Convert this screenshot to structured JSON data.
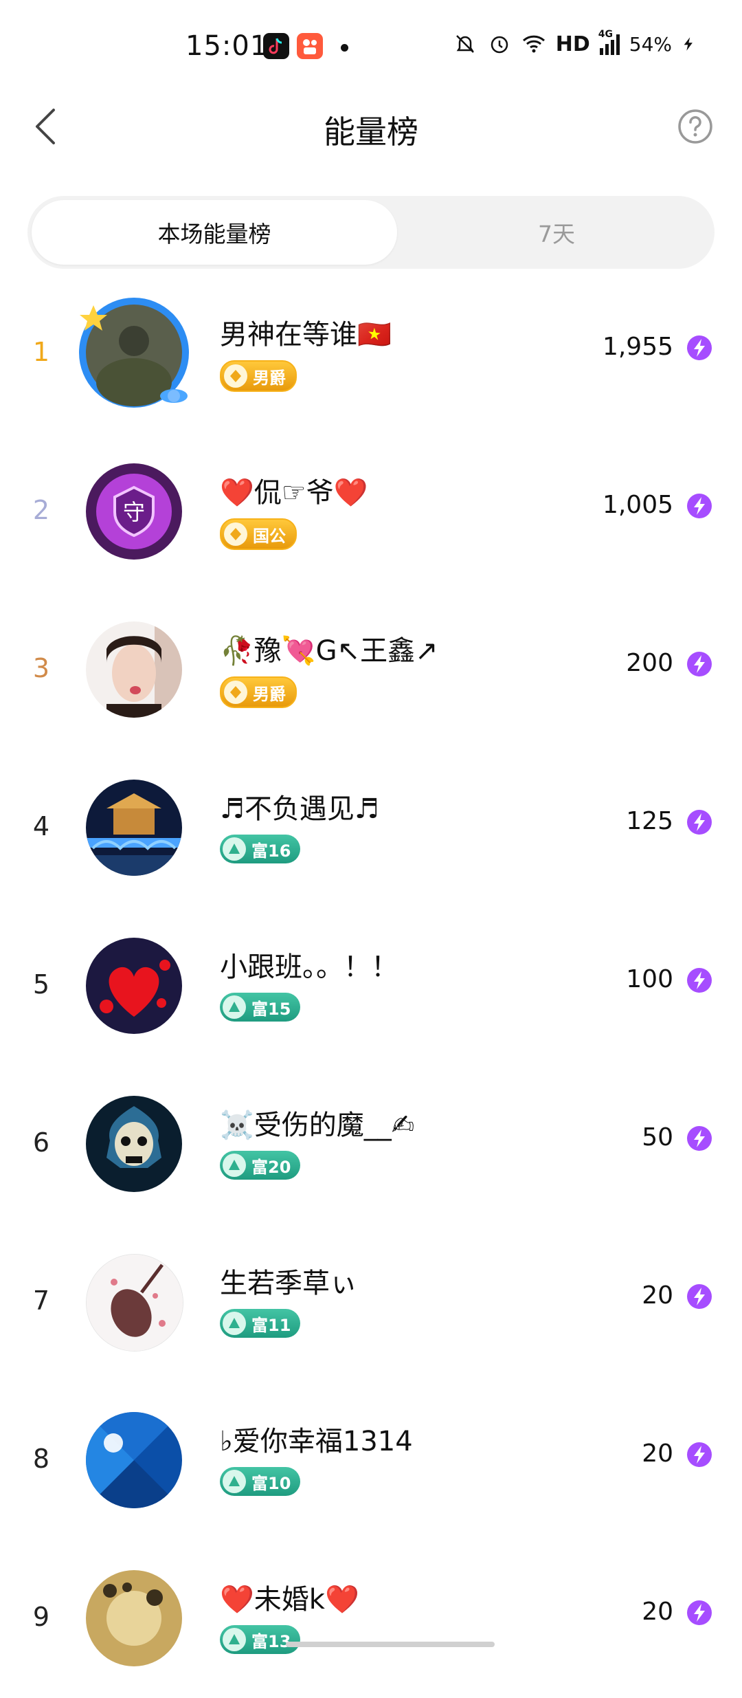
{
  "status_bar": {
    "time": "15:01",
    "network": "HD",
    "signal_label": "4G",
    "battery": "54%"
  },
  "header": {
    "title": "能量榜",
    "back_icon": "chevron-left-icon",
    "help_icon": "question-circle-icon"
  },
  "tabs": [
    {
      "label": "本场能量榜",
      "active": true
    },
    {
      "label": "7天",
      "active": false
    }
  ],
  "ranking": [
    {
      "rank": "1",
      "name": "男神在等谁🇻🇳",
      "badge": "男爵",
      "badge_type": "gold",
      "energy": "1,955"
    },
    {
      "rank": "2",
      "name": "❤️侃☞爷❤️",
      "badge": "国公",
      "badge_type": "gold",
      "energy": "1,005"
    },
    {
      "rank": "3",
      "name": "🥀豫💘G↖王鑫↗",
      "badge": "男爵",
      "badge_type": "gold",
      "energy": "200"
    },
    {
      "rank": "4",
      "name": "♬不负遇见♬",
      "badge": "富16",
      "badge_type": "green",
      "energy": "125"
    },
    {
      "rank": "5",
      "name": "小跟班。。！！",
      "badge": "富15",
      "badge_type": "green",
      "energy": "100"
    },
    {
      "rank": "6",
      "name": "☠️受伤的魔__✍",
      "badge": "富20",
      "badge_type": "green",
      "energy": "50"
    },
    {
      "rank": "7",
      "name": "生若季草ぃ",
      "badge": "富11",
      "badge_type": "green",
      "energy": "20"
    },
    {
      "rank": "8",
      "name": "♭爱你幸福1314",
      "badge": "富10",
      "badge_type": "green",
      "energy": "20"
    },
    {
      "rank": "9",
      "name": "❤️未婚k❤️",
      "badge": "富13",
      "badge_type": "green",
      "energy": "20"
    }
  ],
  "colors": {
    "rank1": "#f0a81a",
    "rank2": "#a7acd6",
    "rank3": "#d18b4a",
    "energy_icon": "#a64dff"
  }
}
